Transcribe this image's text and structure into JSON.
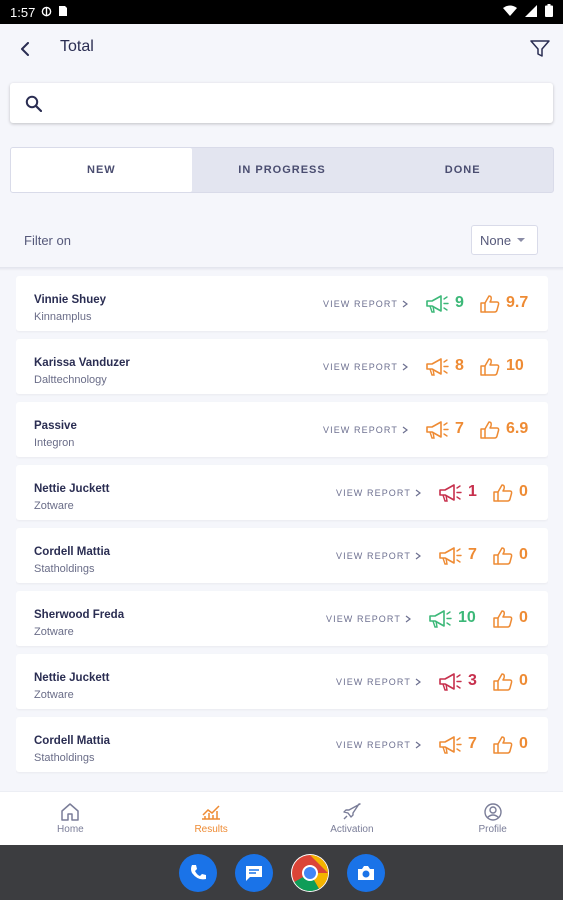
{
  "statusbar": {
    "time": "1:57"
  },
  "header": {
    "title": "Total"
  },
  "search": {
    "placeholder": ""
  },
  "tabs": [
    {
      "label": "NEW",
      "active": true
    },
    {
      "label": "IN PROGRESS",
      "active": false
    },
    {
      "label": "DONE",
      "active": false
    }
  ],
  "filter": {
    "label": "Filter on",
    "value": "None"
  },
  "colors": {
    "green": "#3cb878",
    "orange": "#ee8b34",
    "red": "#c7304d",
    "accent": "#ee8b34",
    "text": "#2a2d52"
  },
  "view_report_label": "VIEW REPORT",
  "contacts": [
    {
      "name": "Vinnie Shuey",
      "company": "Kinnamplus",
      "score": "9",
      "score_color": "green",
      "rating": "9.7"
    },
    {
      "name": "Karissa Vanduzer",
      "company": "Dalttechnology",
      "score": "8",
      "score_color": "orange",
      "rating": "10"
    },
    {
      "name": "Passive",
      "company": "Integron",
      "score": "7",
      "score_color": "orange",
      "rating": "6.9"
    },
    {
      "name": "Nettie Juckett",
      "company": "Zotware",
      "score": "1",
      "score_color": "red",
      "rating": "0"
    },
    {
      "name": "Cordell Mattia",
      "company": "Statholdings",
      "score": "7",
      "score_color": "orange",
      "rating": "0"
    },
    {
      "name": "Sherwood Freda",
      "company": "Zotware",
      "score": "10",
      "score_color": "green",
      "rating": "0"
    },
    {
      "name": "Nettie Juckett",
      "company": "Zotware",
      "score": "3",
      "score_color": "red",
      "rating": "0"
    },
    {
      "name": "Cordell Mattia",
      "company": "Statholdings",
      "score": "7",
      "score_color": "orange",
      "rating": "0"
    }
  ],
  "bottom_nav": [
    {
      "label": "Home",
      "icon": "home-icon",
      "active": false
    },
    {
      "label": "Results",
      "icon": "results-icon",
      "active": true
    },
    {
      "label": "Activation",
      "icon": "rocket-icon",
      "active": false
    },
    {
      "label": "Profile",
      "icon": "profile-icon",
      "active": false
    }
  ],
  "dock_apps": [
    {
      "icon": "phone-icon",
      "color": "#1a73e8"
    },
    {
      "icon": "messages-icon",
      "color": "#1a73e8"
    },
    {
      "icon": "chrome-icon",
      "color": "#34a853"
    },
    {
      "icon": "camera-icon",
      "color": "#1a73e8"
    }
  ]
}
